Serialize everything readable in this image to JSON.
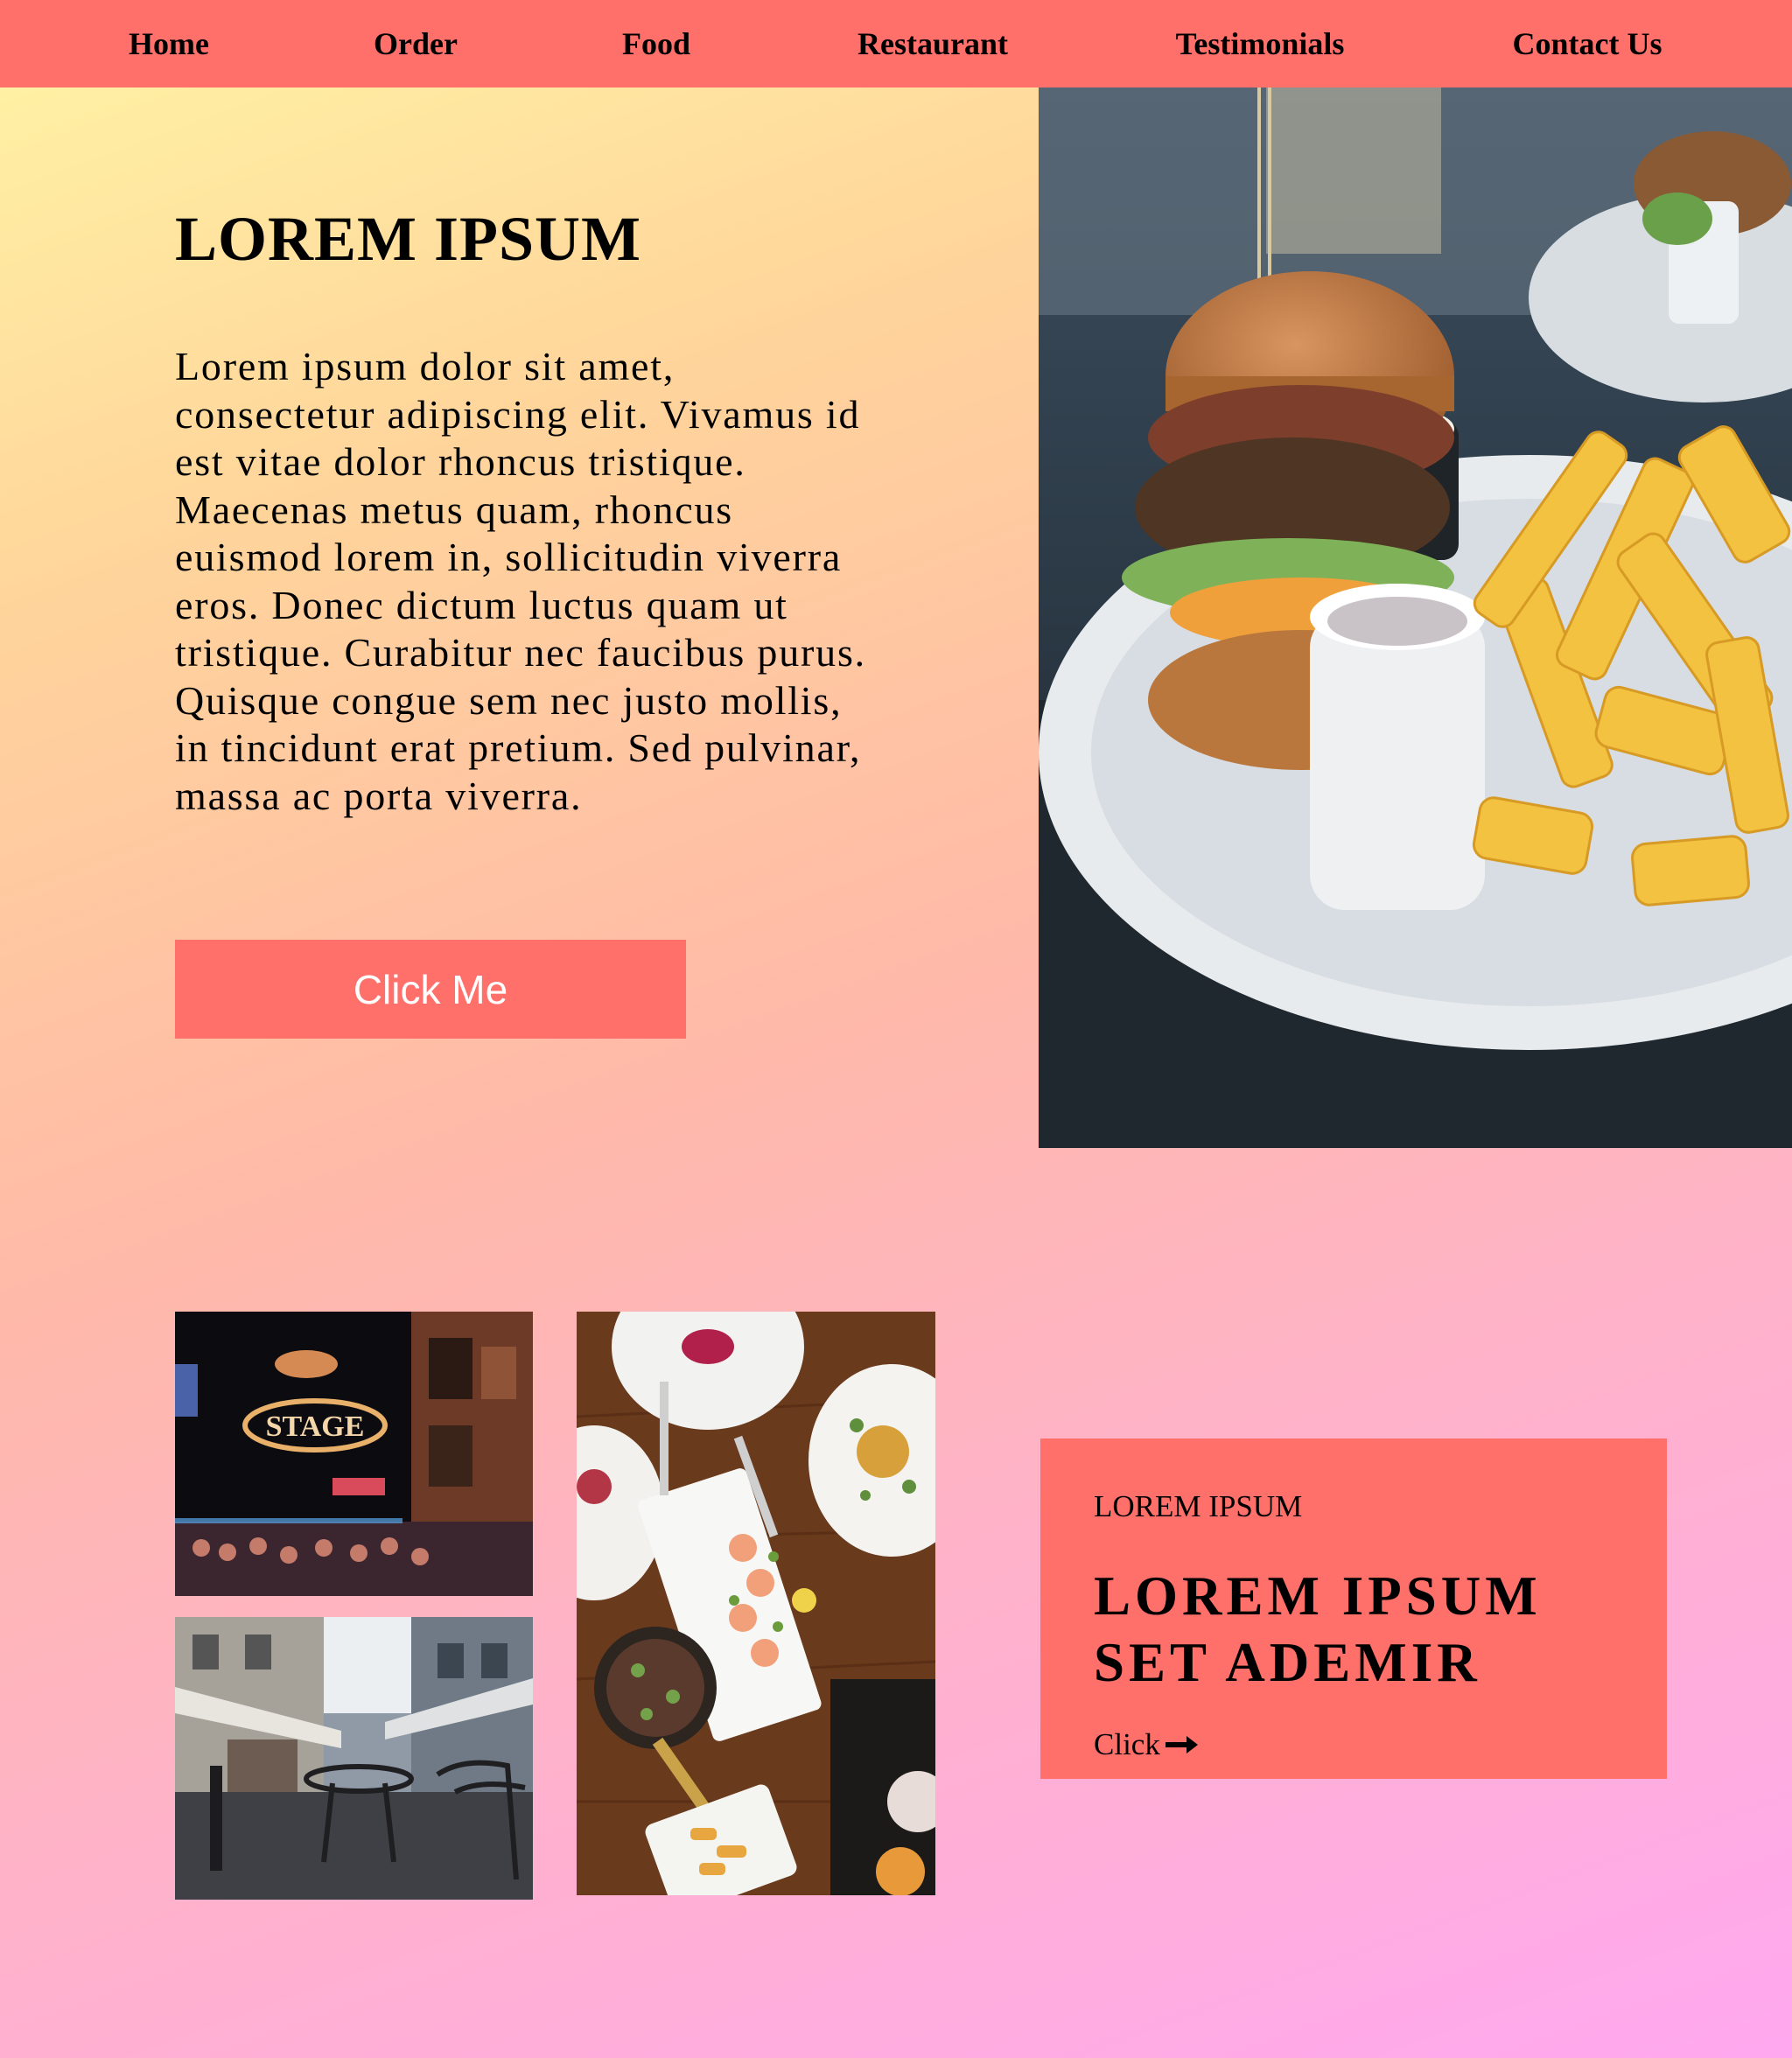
{
  "nav": {
    "items": [
      {
        "label": "Home"
      },
      {
        "label": "Order"
      },
      {
        "label": "Food"
      },
      {
        "label": "Restaurant"
      },
      {
        "label": "Testimonials"
      },
      {
        "label": "Contact Us"
      }
    ]
  },
  "hero": {
    "title": "LOREM IPSUM",
    "text": "Lorem ipsum dolor sit amet, consectetur adipiscing elit. Vivamus id est vitae dolor rhoncus tristique. Maecenas metus quam, rhoncus euismod lorem in, sollicitudin viverra eros. Donec dictum luctus quam ut tristique. Curabitur nec faucibus purus. Quisque congue sem nec justo mollis, in tincidunt erat pretium. Sed pulvinar, massa ac porta viverra.",
    "button_label": "Click Me"
  },
  "card": {
    "eyebrow": "LOREM IPSUM",
    "title_line1": "LOREM IPSUM",
    "title_line2": "SET ADEMIR",
    "link_label": "Click"
  },
  "icons": {
    "arrow": "arrow-right-icon"
  },
  "colors": {
    "accent": "#ff706b",
    "gradient_start": "#fff5a5",
    "gradient_end": "#ffa8f0"
  }
}
